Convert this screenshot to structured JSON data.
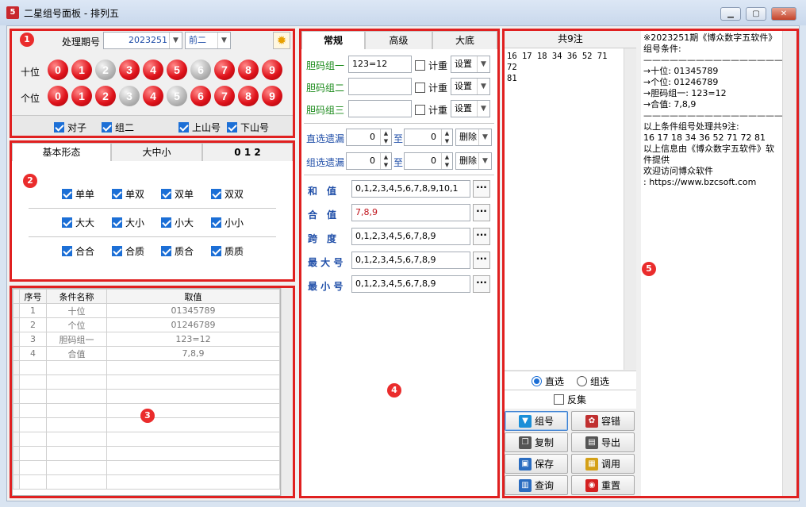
{
  "window": {
    "title": "二星组号面板 - 排列五",
    "app_icon_glyph": "5"
  },
  "badges": [
    "1",
    "2",
    "3",
    "4",
    "5"
  ],
  "panel1": {
    "period_label": "处理期号",
    "period_value": "2023251",
    "prev_value": "前二",
    "rows": [
      {
        "label": "十位",
        "balls": [
          "0",
          "1",
          "2",
          "3",
          "4",
          "5",
          "6",
          "7",
          "8",
          "9"
        ],
        "states": [
          "red",
          "red",
          "gray",
          "red",
          "red",
          "red",
          "gray",
          "red",
          "red",
          "red"
        ]
      },
      {
        "label": "个位",
        "balls": [
          "0",
          "1",
          "2",
          "3",
          "4",
          "5",
          "6",
          "7",
          "8",
          "9"
        ],
        "states": [
          "red",
          "red",
          "red",
          "gray",
          "red",
          "gray",
          "red",
          "red",
          "red",
          "red"
        ]
      }
    ],
    "checks": [
      "对子",
      "组二",
      "上山号",
      "下山号"
    ]
  },
  "panel2": {
    "tabs": [
      "基本形态",
      "大中小",
      "0 1 2"
    ],
    "rows": [
      [
        "单单",
        "单双",
        "双单",
        "双双"
      ],
      [
        "大大",
        "大小",
        "小大",
        "小小"
      ],
      [
        "合合",
        "合质",
        "质合",
        "质质"
      ]
    ]
  },
  "panel3": {
    "headers": [
      "序号",
      "条件名称",
      "取值"
    ],
    "rows": [
      [
        "1",
        "十位",
        "01345789"
      ],
      [
        "2",
        "个位",
        "01246789"
      ],
      [
        "3",
        "胆码组一",
        "123=12"
      ],
      [
        "4",
        "合值",
        "7,8,9"
      ]
    ]
  },
  "panel4": {
    "tabs": [
      "常规",
      "高级",
      "大底"
    ],
    "dan": [
      {
        "label": "胆码组一",
        "value": "123=12"
      },
      {
        "label": "胆码组二",
        "value": ""
      },
      {
        "label": "胆码组三",
        "value": ""
      }
    ],
    "count_label": "计重",
    "setting_label": "设置",
    "miss": [
      {
        "label": "直选遗漏",
        "from": "0",
        "to_label": "至",
        "to": "0",
        "action": "删除"
      },
      {
        "label": "组选遗漏",
        "from": "0",
        "to_label": "至",
        "to": "0",
        "action": "删除"
      }
    ],
    "params": [
      {
        "label": "和　值",
        "value": "0,1,2,3,4,5,6,7,8,9,10,1"
      },
      {
        "label": "合　值",
        "value": "7,8,9"
      },
      {
        "label": "跨　度",
        "value": "0,1,2,3,4,5,6,7,8,9"
      },
      {
        "label": "最 大 号",
        "value": "0,1,2,3,4,5,6,7,8,9"
      },
      {
        "label": "最 小 号",
        "value": "0,1,2,3,4,5,6,7,8,9"
      }
    ],
    "dots": "···"
  },
  "panel5": {
    "result_header": "共9注",
    "result_numbers": "16 17 18 34 36 52 71 72\n81",
    "radio_direct": "直选",
    "radio_group": "组选",
    "reverse": "反集",
    "buttons": [
      "组号",
      "容错",
      "复制",
      "导出",
      "保存",
      "调用",
      "查询",
      "重置"
    ],
    "info_text": "※2023251期《博众数字五软件》组号条件:\n——————————————————\n→十位: 01345789\n→个位: 01246789\n→胆码组一: 123=12\n→合值: 7,8,9\n——————————————————\n以上条件组号处理共9注:\n16 17 18 34 36 52 71 72 81\n以上信息由《博众数字五软件》软件提供\n欢迎访问博众软件\n: https://www.bzcsoft.com"
  },
  "colors": {
    "red_frame": "#e02020",
    "ball_red": "#e0141c",
    "ball_gray": "#b8b8b8",
    "check_blue": "#1c6fd6",
    "label_green": "#1a8a1a",
    "label_blue": "#1f4ea8",
    "value_red": "#c0141c"
  }
}
